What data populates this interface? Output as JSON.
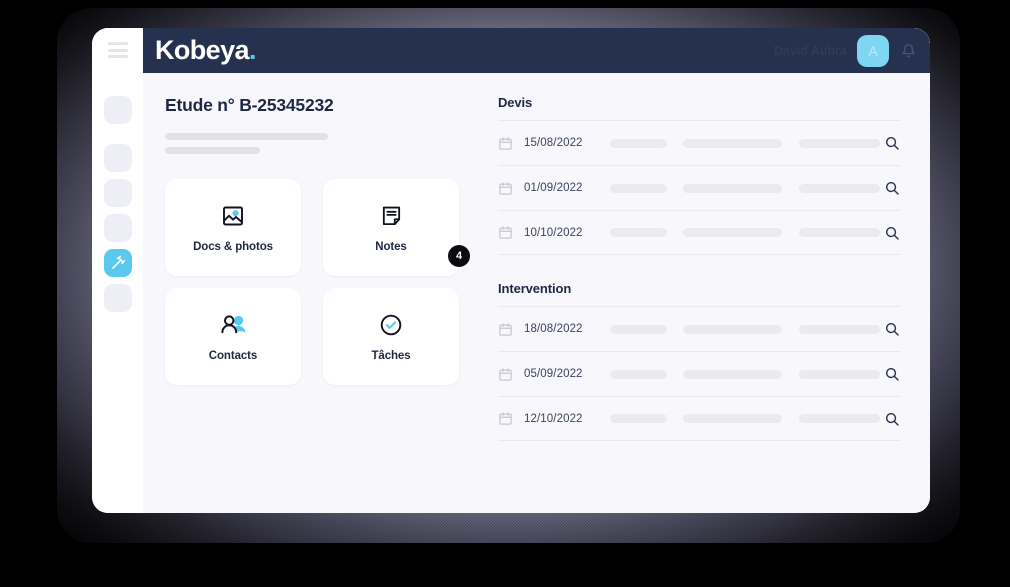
{
  "brand": {
    "logo_text": "Kobeya",
    "logo_dot": ".",
    "accent_color": "#5bc8ee",
    "header_color": "#26314f",
    "screen_bg": "#f7f7fc"
  },
  "topbar": {
    "menu_icon": "hamburger-icon",
    "user_name": "David Aubra",
    "avatar_initial": "A",
    "notification_icon": "bell-icon"
  },
  "sidebar": {
    "items": [
      {
        "name": "nav-placeholder-1",
        "icon": "placeholder-icon",
        "active": false
      },
      {
        "name": "nav-placeholder-2",
        "icon": "placeholder-icon",
        "active": false
      },
      {
        "name": "nav-placeholder-3",
        "icon": "placeholder-icon",
        "active": false
      },
      {
        "name": "nav-placeholder-4",
        "icon": "placeholder-icon",
        "active": false
      },
      {
        "name": "nav-tools",
        "icon": "hammer-icon",
        "active": true
      },
      {
        "name": "nav-placeholder-5",
        "icon": "placeholder-icon",
        "active": false
      }
    ]
  },
  "main": {
    "page_title": "Etude n° B-25345232",
    "subtitle_placeholder_1": "",
    "subtitle_placeholder_2": "",
    "tiles": [
      {
        "label": "Docs & photos",
        "icon": "image-icon",
        "badge": ""
      },
      {
        "label": "Notes",
        "icon": "note-icon",
        "badge": "4"
      },
      {
        "label": "Contacts",
        "icon": "contacts-icon",
        "badge": ""
      },
      {
        "label": "Tâches",
        "icon": "check-circle-icon",
        "badge": ""
      }
    ]
  },
  "panels": [
    {
      "title": "Devis",
      "rows": [
        {
          "date": "15/08/2022",
          "calendar_icon": "calendar-icon",
          "search_icon": "search-icon"
        },
        {
          "date": "01/09/2022",
          "calendar_icon": "calendar-icon",
          "search_icon": "search-icon"
        },
        {
          "date": "10/10/2022",
          "calendar_icon": "calendar-icon",
          "search_icon": "search-icon"
        }
      ]
    },
    {
      "title": "Intervention",
      "rows": [
        {
          "date": "18/08/2022",
          "calendar_icon": "calendar-icon",
          "search_icon": "search-icon"
        },
        {
          "date": "05/09/2022",
          "calendar_icon": "calendar-icon",
          "search_icon": "search-icon"
        },
        {
          "date": "12/10/2022",
          "calendar_icon": "calendar-icon",
          "search_icon": "search-icon"
        }
      ]
    }
  ]
}
